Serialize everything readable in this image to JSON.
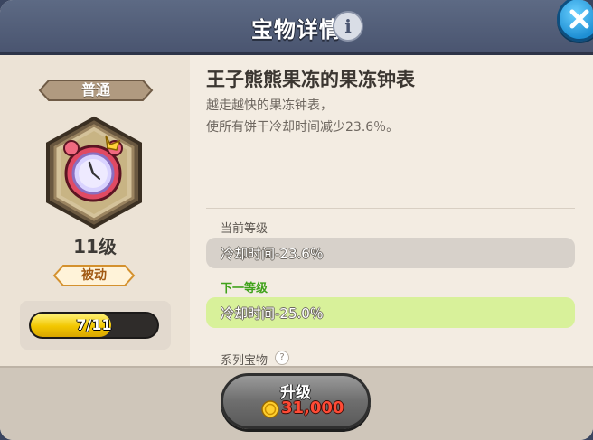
{
  "header": {
    "title": "宝物详情",
    "info_icon": "info-icon",
    "close_icon": "close-icon"
  },
  "treasure": {
    "rarity": "普通",
    "level": "11级",
    "type_badge": "被动",
    "progress_text": "7/11",
    "progress_current": 7,
    "progress_total": 11,
    "name": "王子熊熊果冻的果冻钟表",
    "description_lines": [
      "越走越快的果冻钟表，",
      "使所有饼干冷却时间减少23.6％。"
    ],
    "icon": "jelly-clock-icon"
  },
  "stats": {
    "current_label": "当前等级",
    "current_value": "冷却时间-23.6％",
    "next_label": "下一等级",
    "next_value": "冷却时间-25.0％",
    "series_label": "系列宝物"
  },
  "upgrade": {
    "label": "升级",
    "cost": "31,000",
    "currency_icon": "coin-icon"
  },
  "colors": {
    "next_level_green": "#3fa21a",
    "next_level_box": "#d8f19a",
    "current_level_box": "#d7d1ca",
    "cost_red": "#ff4a35",
    "progress_yellow": "#f2c600"
  }
}
